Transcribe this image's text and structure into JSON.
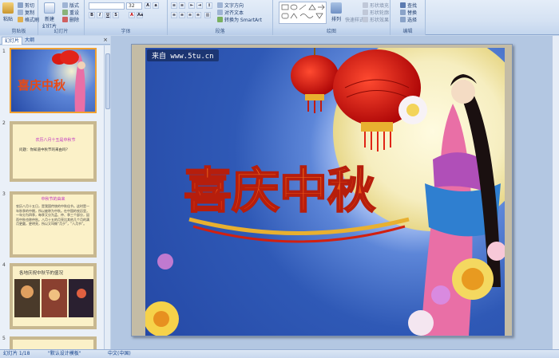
{
  "ribbon": {
    "clipboard": {
      "paste": "粘贴",
      "cut": "剪切",
      "copy": "复制",
      "format_painter": "格式刷",
      "group": "剪贴板"
    },
    "slides": {
      "new_slide": "新建\n幻灯片",
      "layout": "版式",
      "reset": "重设",
      "delete": "删除",
      "group": "幻灯片"
    },
    "font": {
      "font_name": "",
      "font_size": "32",
      "group": "字体"
    },
    "paragraph": {
      "text_direction": "文字方向",
      "align_text": "对齐文本",
      "smartart": "转换为 SmartArt",
      "group": "段落"
    },
    "drawing": {
      "arrange": "排列",
      "quick_styles": "快速样式",
      "shape_fill": "形状填充",
      "shape_outline": "形状轮廓",
      "shape_effects": "形状效果",
      "group": "绘图"
    },
    "editing": {
      "find": "查找",
      "replace": "替换",
      "select": "选择",
      "group": "编辑"
    }
  },
  "panel": {
    "tabs": [
      "幻灯片",
      "大纲"
    ],
    "close": "×",
    "thumbs": [
      {
        "num": "1"
      },
      {
        "num": "2",
        "title": "农历八月十五是中秋节",
        "text": "问题：你知道中秋节的来由吗？"
      },
      {
        "num": "3",
        "title": "中秋节的由来",
        "text": "农历八月十五日，是我国传统的中秋佳节。这时是一年秋季的中期，所以被称为中秋。在中国的农历里，一年分为四季，每季又分为孟、仲、季三个部分，因而中秋也称仲秋。八月十五的月亮比其他几个月的满月更圆，更明亮，所以又叫做“月夕”，“八月节”。"
      },
      {
        "num": "4",
        "title": "各地庆祝中秋节的盛况"
      },
      {
        "num": "5"
      }
    ]
  },
  "slide": {
    "watermark": "来自 www.5tu.cn",
    "title_art": "喜庆中秋"
  },
  "status": {
    "slide_info": "幻灯片 1/18",
    "theme": "\"默认设计模板\"",
    "language": "中文(中国)"
  },
  "colors": {
    "accent": "#f0a030",
    "ribbon": "#dbe6f4",
    "title_red": "#e03010"
  }
}
